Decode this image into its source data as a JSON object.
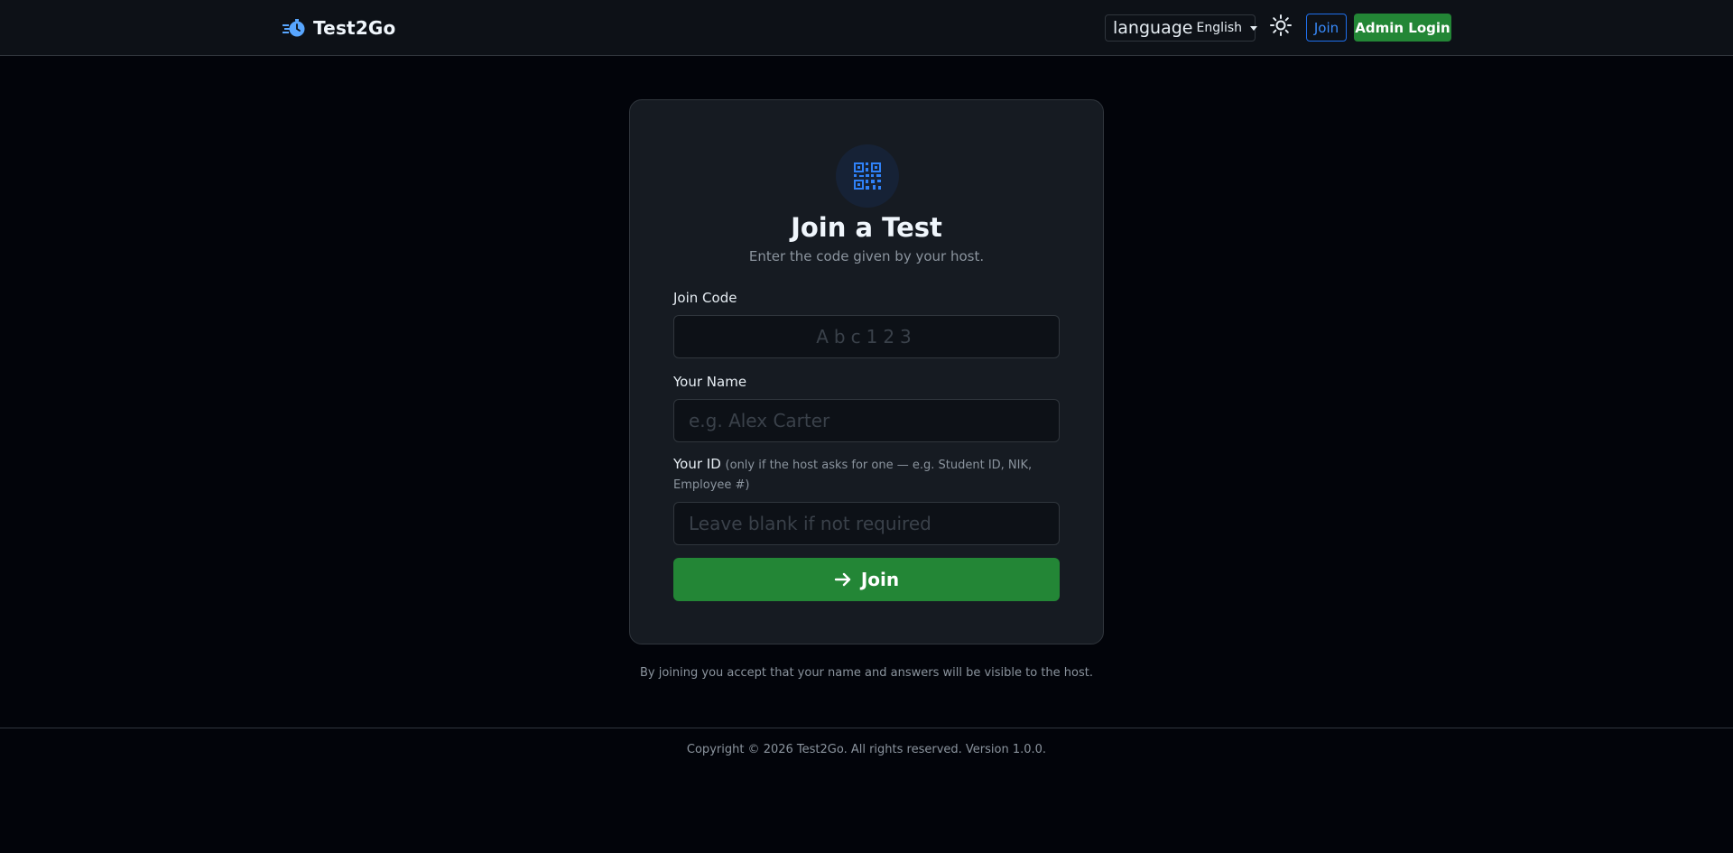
{
  "navbar": {
    "brand_name": "Test2Go",
    "language_label": "language",
    "language_value": "English",
    "join_label": "Join",
    "admin_login_label": "Admin Login"
  },
  "card": {
    "title": "Join a Test",
    "subtitle": "Enter the code given by your host.",
    "join_code": {
      "label": "Join Code",
      "placeholder": "Abc123",
      "value": ""
    },
    "name": {
      "label": "Your Name",
      "placeholder": "e.g. Alex Carter",
      "value": ""
    },
    "id_field": {
      "label": "Your ID",
      "hint": "(only if the host asks for one — e.g. Student ID, NIK, Employee #)",
      "placeholder": "Leave blank if not required",
      "value": ""
    },
    "submit_label": "Join"
  },
  "consent_text": "By joining you accept that your name and answers will be visible to the host.",
  "footer": {
    "copyright": "Copyright © 2026 Test2Go. All rights reserved. Version 1.0.0."
  },
  "icons": {
    "logo": "stopwatch-speed-icon",
    "theme": "sun-icon",
    "card": "qr-code-icon",
    "submit": "arrow-right-icon"
  },
  "colors": {
    "background": "#02040a",
    "surface": "#161b22",
    "border": "#30363d",
    "primary_blue": "#1f6feb",
    "success_green": "#238636",
    "muted_text": "#8b949e"
  }
}
